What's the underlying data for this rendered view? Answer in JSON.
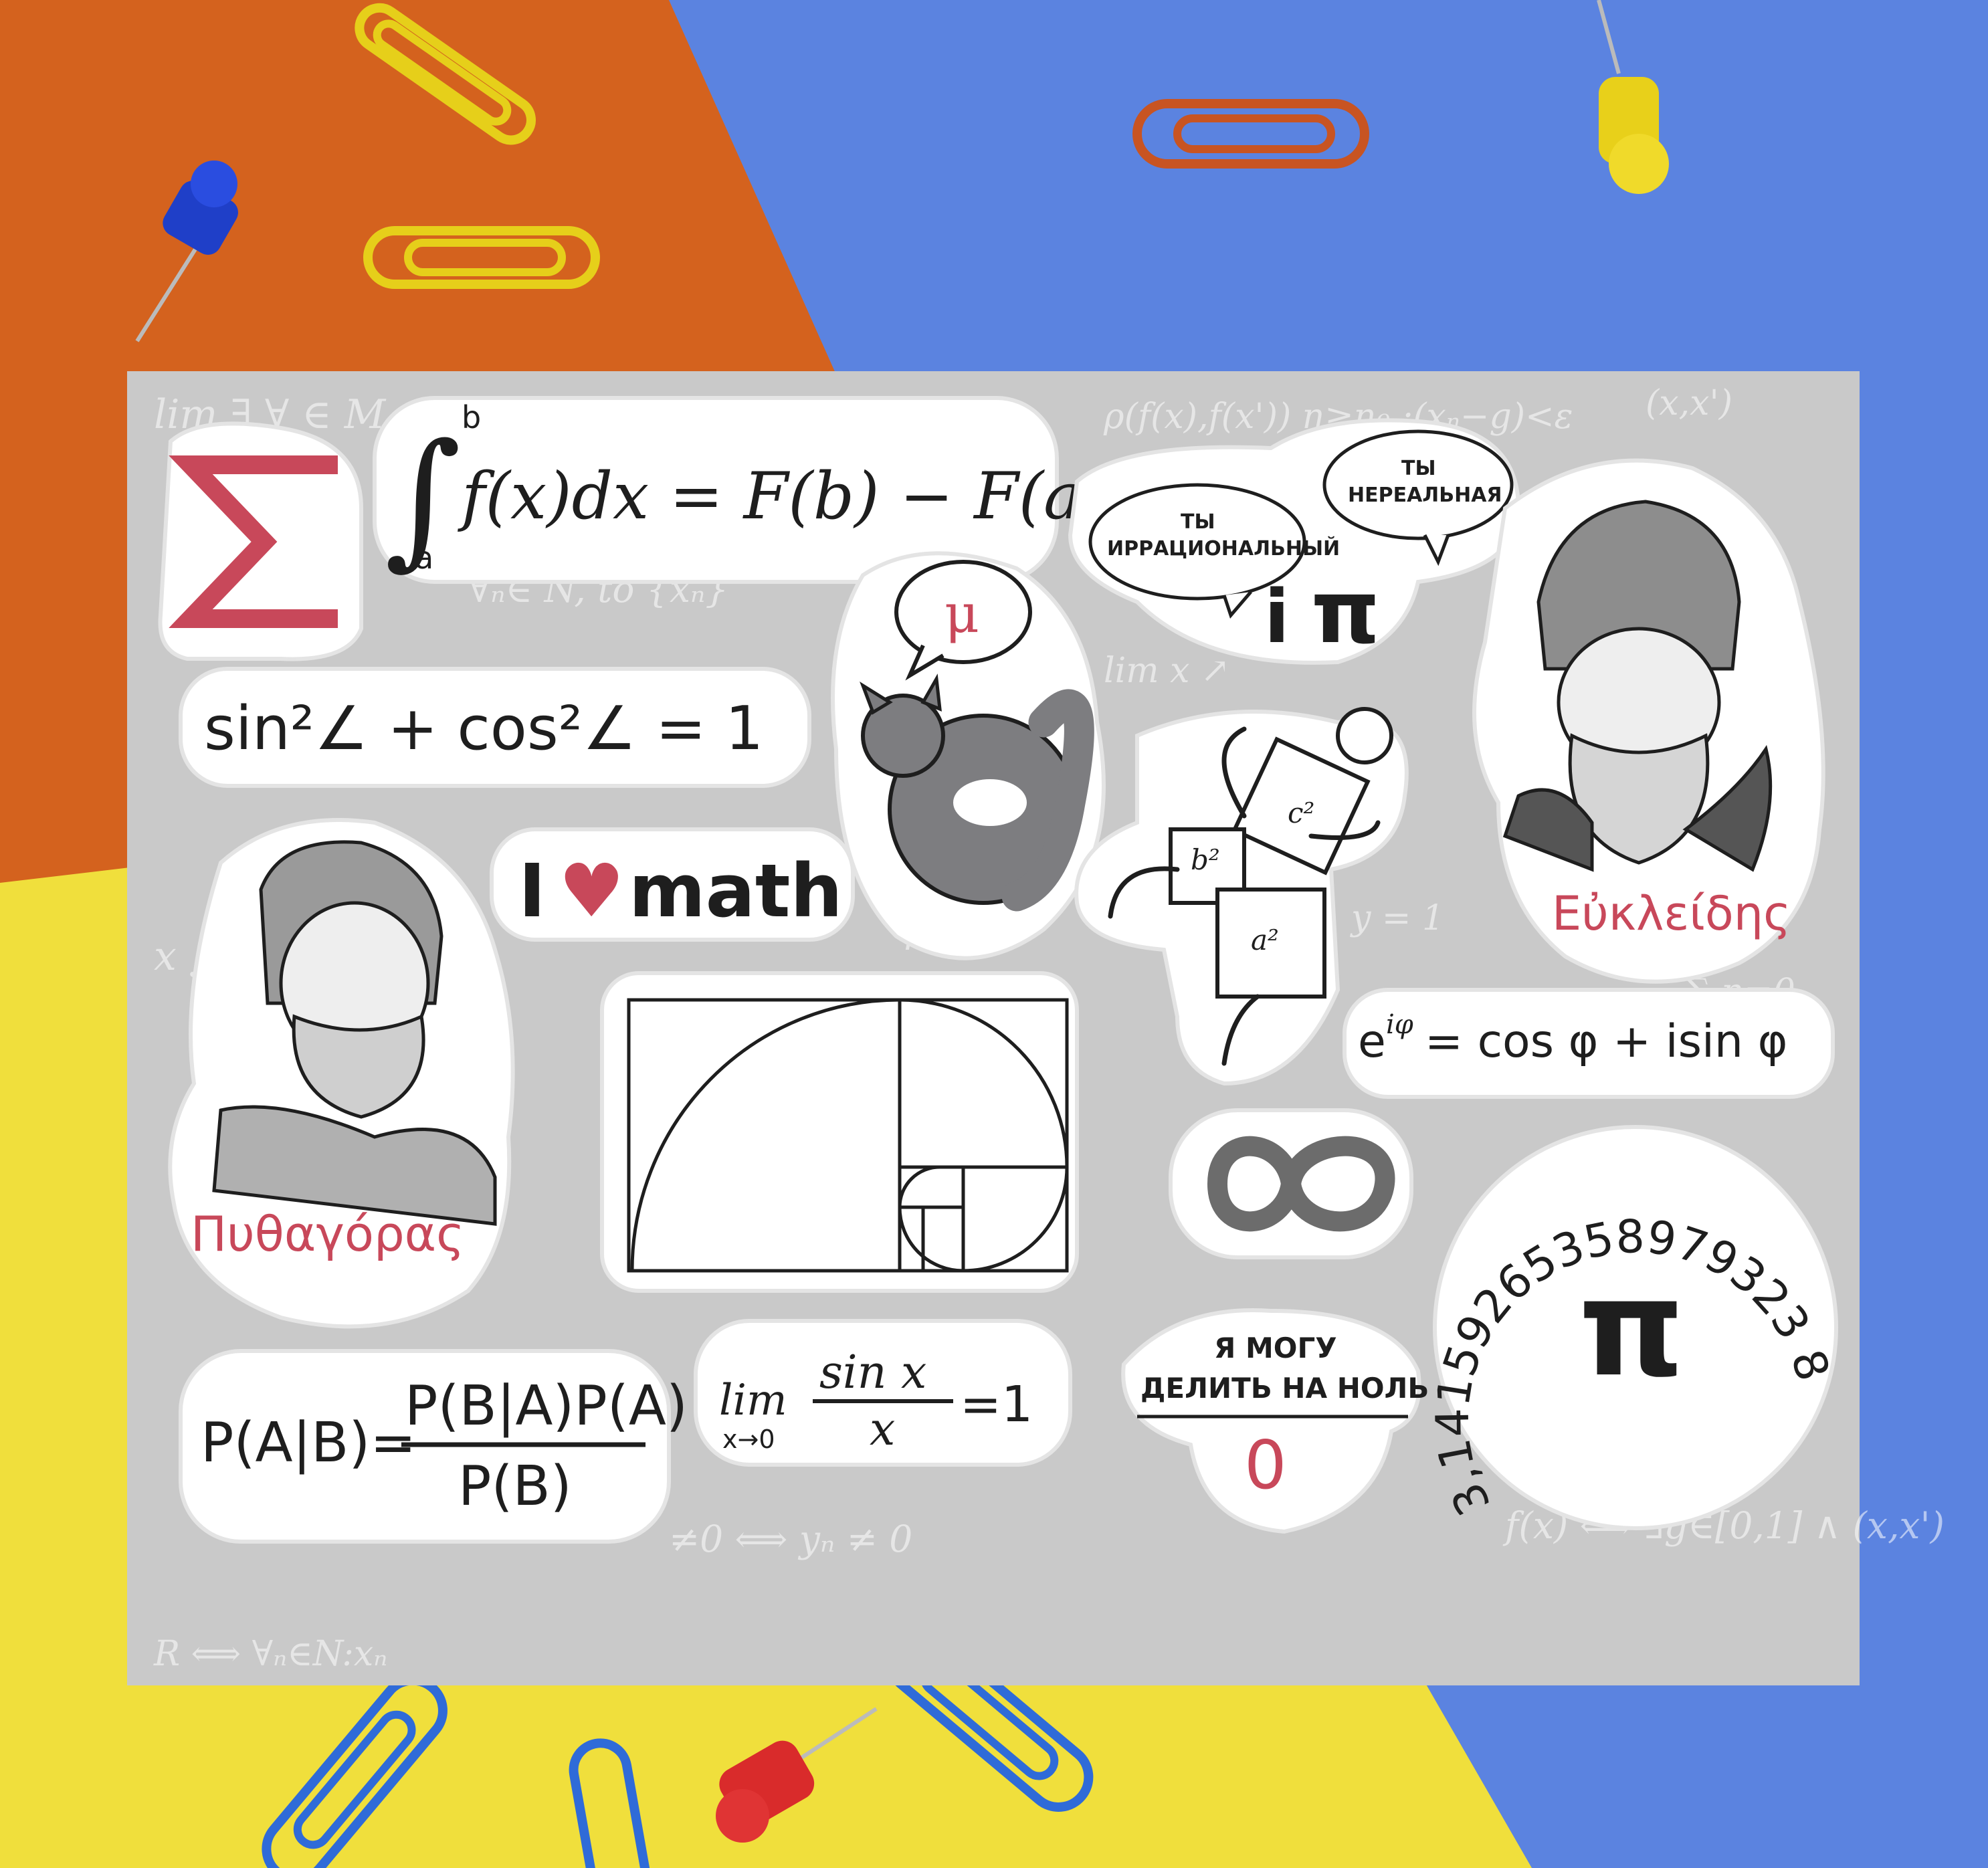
{
  "colors": {
    "orange": "#d4621e",
    "blue": "#5b83e0",
    "yellow": "#f0df3c",
    "sheet": "#c9c9c9",
    "accent_red": "#c8485a",
    "ink": "#1e1e1e",
    "cat_gray": "#7d7d80"
  },
  "stickers": {
    "sigma": {
      "glyph": "∑"
    },
    "integral": {
      "sign": "∫",
      "upper": "b",
      "lower": "a",
      "body": "f(x)dx = F(b) − F(a)"
    },
    "trig_identity": {
      "text": "sin²∠ + cos²∠ = 1"
    },
    "cat": {
      "speech": "μ",
      "icon": "cat-icon"
    },
    "i_pi": {
      "bubble_left": [
        "ТЫ",
        "ИРРАЦИОНАЛЬНЫЙ"
      ],
      "bubble_right": [
        "ТЫ",
        "НЕРЕАЛЬНАЯ"
      ],
      "i": "i",
      "pi": "π"
    },
    "euclid": {
      "caption": "Εὐκλείδης",
      "icon": "euclid-portrait"
    },
    "pythagoras_figure": {
      "c": "c²",
      "b": "b²",
      "a": "a²",
      "icon": "pythagorean-figure"
    },
    "i_love_math": {
      "i": "I",
      "heart": "♥",
      "word": "math"
    },
    "pythagoras": {
      "caption": "Πυθαγόρας",
      "icon": "pythagoras-portrait"
    },
    "golden_ratio": {
      "icon": "golden-spiral-icon"
    },
    "euler": {
      "base": "e",
      "exponent": "iφ",
      "rest": "= cos φ + isin φ"
    },
    "infinity": {
      "icon": "infinity-ribbon-icon"
    },
    "pi_digits": {
      "digits": "3,14159265358979323 8",
      "symbol": "π"
    },
    "bayes": {
      "left": "P(A|B)=",
      "numerator": "P(B|A)P(A)",
      "denominator": "P(B)"
    },
    "limit": {
      "lim": "lim",
      "sub": "x→0",
      "numerator": "sin x",
      "denominator": "x",
      "result": "=1"
    },
    "divide_zero": {
      "line1": "Я МОГУ",
      "line2": "ДЕЛИТЬ НА НОЛЬ",
      "zero": "0"
    }
  }
}
